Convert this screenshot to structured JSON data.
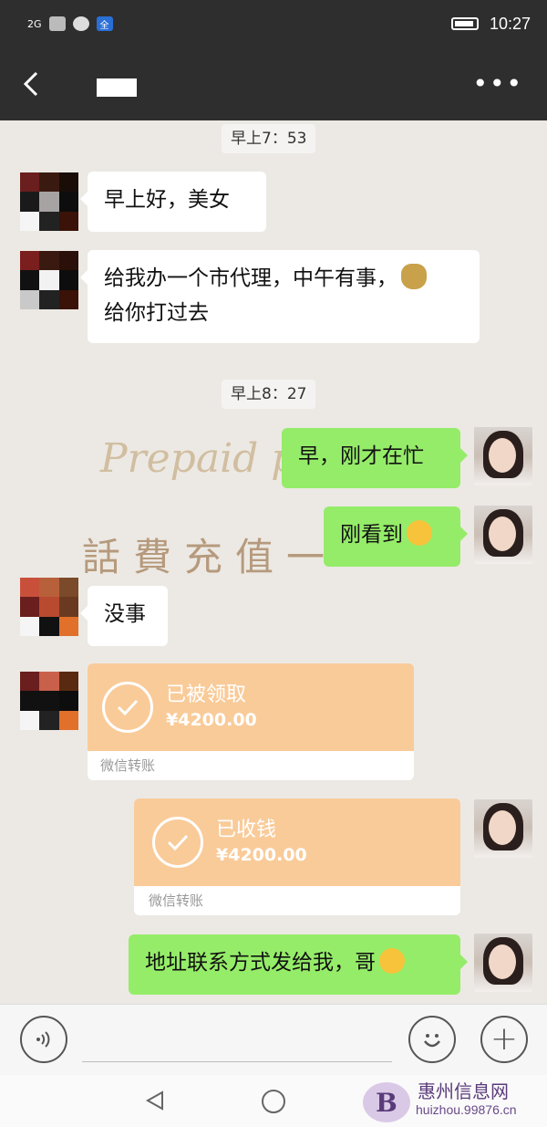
{
  "status_bar": {
    "network": "2G",
    "time": "10:27",
    "badge": "全"
  },
  "header": {
    "more_label": "•••"
  },
  "watermark": {
    "line1": "Prepaid pr",
    "line2": "話費充值一"
  },
  "chat": {
    "timestamps": [
      "早上7：53",
      "早上8：27"
    ],
    "messages": [
      {
        "side": "left",
        "text": "早上好，美女"
      },
      {
        "side": "left",
        "text": "给我办一个市代理，中午有事，",
        "text2": "给你打过去"
      },
      {
        "side": "right",
        "text": "早，刚才在忙"
      },
      {
        "side": "right",
        "text": "刚看到"
      },
      {
        "side": "left",
        "text": "没事"
      },
      {
        "side": "right",
        "text": "地址联系方式发给我，哥"
      }
    ],
    "transfers": [
      {
        "side": "left",
        "status": "已被领取",
        "amount": "¥4200.00",
        "footer": "微信转账"
      },
      {
        "side": "right",
        "status": "已收钱",
        "amount": "¥4200.00",
        "footer": "微信转账"
      }
    ]
  },
  "input_bar": {
    "plus_label": "+"
  },
  "site": {
    "name": "惠州信息网",
    "url": "huizhou.99876.cn",
    "logo_letter": "B"
  },
  "colors": {
    "accent_green": "#95ec69",
    "transfer_orange": "#f9cb99",
    "bar_dark": "#2e2e2e"
  }
}
